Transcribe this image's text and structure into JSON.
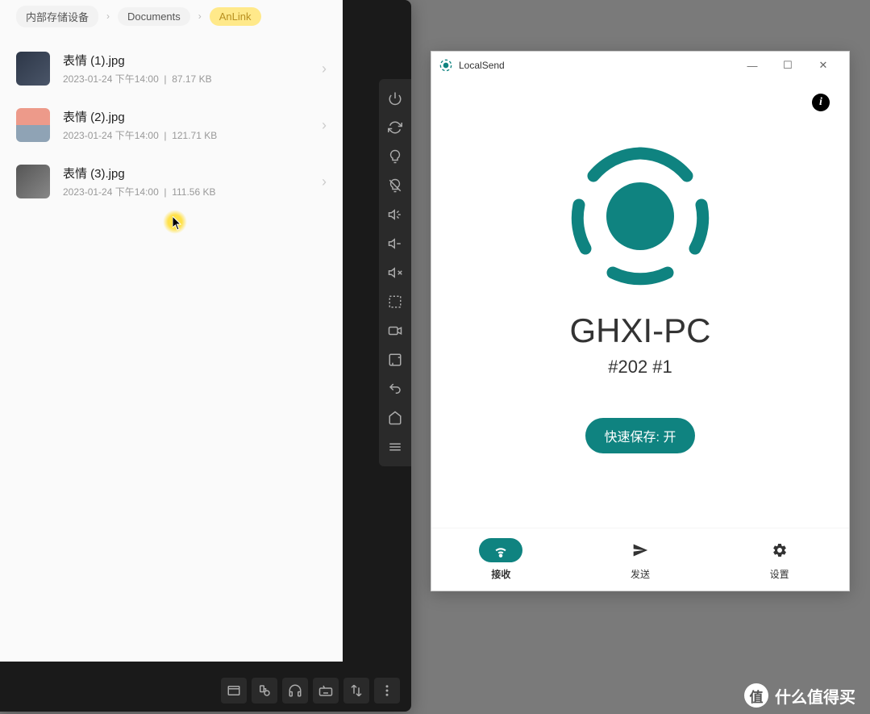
{
  "breadcrumb": {
    "items": [
      {
        "label": "内部存储设备",
        "active": false
      },
      {
        "label": "Documents",
        "active": false
      },
      {
        "label": "AnLink",
        "active": true
      }
    ]
  },
  "files": [
    {
      "name": "表情 (1).jpg",
      "date": "2023-01-24 下午14:00",
      "size": "87.17 KB"
    },
    {
      "name": "表情 (2).jpg",
      "date": "2023-01-24 下午14:00",
      "size": "121.71 KB"
    },
    {
      "name": "表情 (3).jpg",
      "date": "2023-01-24 下午14:00",
      "size": "111.56 KB"
    }
  ],
  "sidetools": {
    "power": "power-icon",
    "rotate": "rotate-icon",
    "bulb": "bulb-icon",
    "bulb_off": "bulb-off-icon",
    "vol_up": "volume-up-icon",
    "vol_down": "volume-down-icon",
    "mute": "mute-icon",
    "fullscreen": "fullscreen-icon",
    "record": "record-icon",
    "screenshot": "screenshot-icon",
    "back": "back-icon",
    "home": "home-icon",
    "menu": "menu-icon"
  },
  "bottomtools": {
    "window": "window-icon",
    "usb": "usb-icon",
    "headphones": "headphones-icon",
    "keyboard": "keyboard-icon",
    "transfer": "transfer-icon",
    "more": "more-icon"
  },
  "localsend": {
    "title": "LocalSend",
    "device_name": "GHXI-PC",
    "device_sub": "#202 #1",
    "quicksave": "快速保存: 开",
    "info": "i",
    "tabs": {
      "receive": "接收",
      "send": "发送",
      "settings": "设置"
    },
    "winctrl": {
      "min": "—",
      "max": "☐",
      "close": "✕"
    }
  },
  "watermark": {
    "badge": "值",
    "text": "什么值得买"
  },
  "colors": {
    "teal": "#0f8380"
  }
}
